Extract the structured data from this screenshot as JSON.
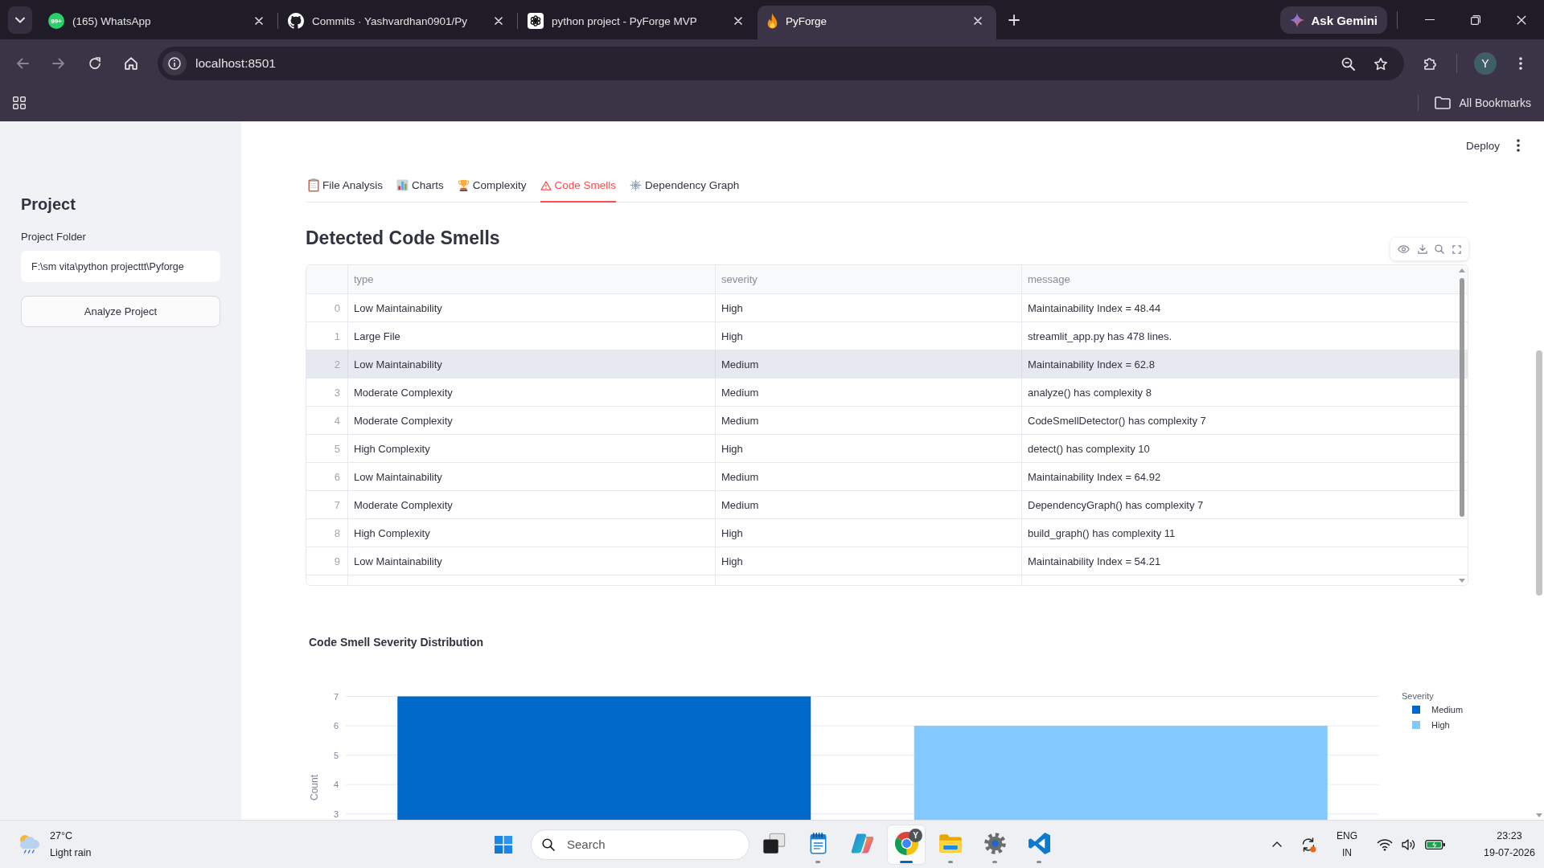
{
  "browser": {
    "tabs": [
      {
        "title": "(165) WhatsApp",
        "badge": "99+",
        "selected": false
      },
      {
        "title": "Commits · Yashvardhan0901/Py",
        "selected": false
      },
      {
        "title": "python project - PyForge MVP",
        "selected": false
      },
      {
        "title": "PyForge",
        "selected": true
      }
    ],
    "ask_gemini_button": "Ask Gemini",
    "address": "localhost:8501",
    "profile_initial": "Y",
    "bookmarks_button": "All Bookmarks"
  },
  "app": {
    "header": {
      "deploy_button": "Deploy"
    },
    "sidebar": {
      "title": "Project",
      "folder_field": {
        "label": "Project Folder",
        "value": "F:\\sm vita\\python projecttt\\Pyforge"
      },
      "analyze_button": "Analyze Project"
    },
    "tabs": [
      {
        "label": "File Analysis",
        "selected": false
      },
      {
        "label": "Charts",
        "selected": false
      },
      {
        "label": "Complexity",
        "selected": false
      },
      {
        "label": "Code Smells",
        "selected": true
      },
      {
        "label": "Dependency Graph",
        "selected": false
      }
    ],
    "section_title": "Detected Code Smells",
    "table": {
      "columns": [
        "type",
        "severity",
        "message"
      ],
      "rows": [
        {
          "index": "0",
          "cells": [
            "Low Maintainability",
            "High",
            "Maintainability Index = 48.44"
          ],
          "hovered": false
        },
        {
          "index": "1",
          "cells": [
            "Large File",
            "High",
            "streamlit_app.py has 478 lines."
          ],
          "hovered": false
        },
        {
          "index": "2",
          "cells": [
            "Low Maintainability",
            "Medium",
            "Maintainability Index = 62.8"
          ],
          "hovered": true
        },
        {
          "index": "3",
          "cells": [
            "Moderate Complexity",
            "Medium",
            "analyze() has complexity 8"
          ],
          "hovered": false
        },
        {
          "index": "4",
          "cells": [
            "Moderate Complexity",
            "Medium",
            "CodeSmellDetector() has complexity 7"
          ],
          "hovered": false
        },
        {
          "index": "5",
          "cells": [
            "High Complexity",
            "High",
            "detect() has complexity 10"
          ],
          "hovered": false
        },
        {
          "index": "6",
          "cells": [
            "Low Maintainability",
            "Medium",
            "Maintainability Index = 64.92"
          ],
          "hovered": false
        },
        {
          "index": "7",
          "cells": [
            "Moderate Complexity",
            "Medium",
            "DependencyGraph() has complexity 7"
          ],
          "hovered": false
        },
        {
          "index": "8",
          "cells": [
            "High Complexity",
            "High",
            "build_graph() has complexity 11"
          ],
          "hovered": false
        },
        {
          "index": "9",
          "cells": [
            "Low Maintainability",
            "High",
            "Maintainability Index = 54.21"
          ],
          "hovered": false
        }
      ]
    },
    "chart": {
      "legend_title": "Severity",
      "chart_data": {
        "type": "bar",
        "title": "Code Smell Severity Distribution",
        "ylabel": "Count",
        "series": [
          {
            "name": "Medium",
            "color": "#0068c9",
            "values": [
              7
            ]
          },
          {
            "name": "High",
            "color": "#83c9ff",
            "values": [
              6
            ]
          }
        ],
        "ylim": [
          2.8,
          7
        ],
        "yticks": [
          {
            "value": 3,
            "label": "3"
          },
          {
            "value": 4,
            "label": "4"
          },
          {
            "value": 5,
            "label": "5"
          },
          {
            "value": 6,
            "label": "6"
          },
          {
            "value": 7,
            "label": "7"
          }
        ],
        "grid": true,
        "legend": "right"
      }
    }
  },
  "taskbar": {
    "weather": {
      "temperature": "27°C",
      "condition": "Light rain"
    },
    "search": {
      "placeholder": "Search"
    },
    "apps": [
      {
        "running": false,
        "active": false
      },
      {
        "running": true,
        "active": false
      },
      {
        "running": false,
        "active": false
      },
      {
        "running": true,
        "active": true,
        "badge": "Y"
      },
      {
        "running": true,
        "active": false
      },
      {
        "running": true,
        "active": false
      },
      {
        "running": true,
        "active": false
      }
    ],
    "language": "ENG",
    "region": "IN",
    "time": "23:23",
    "date": "19-07-2026"
  }
}
